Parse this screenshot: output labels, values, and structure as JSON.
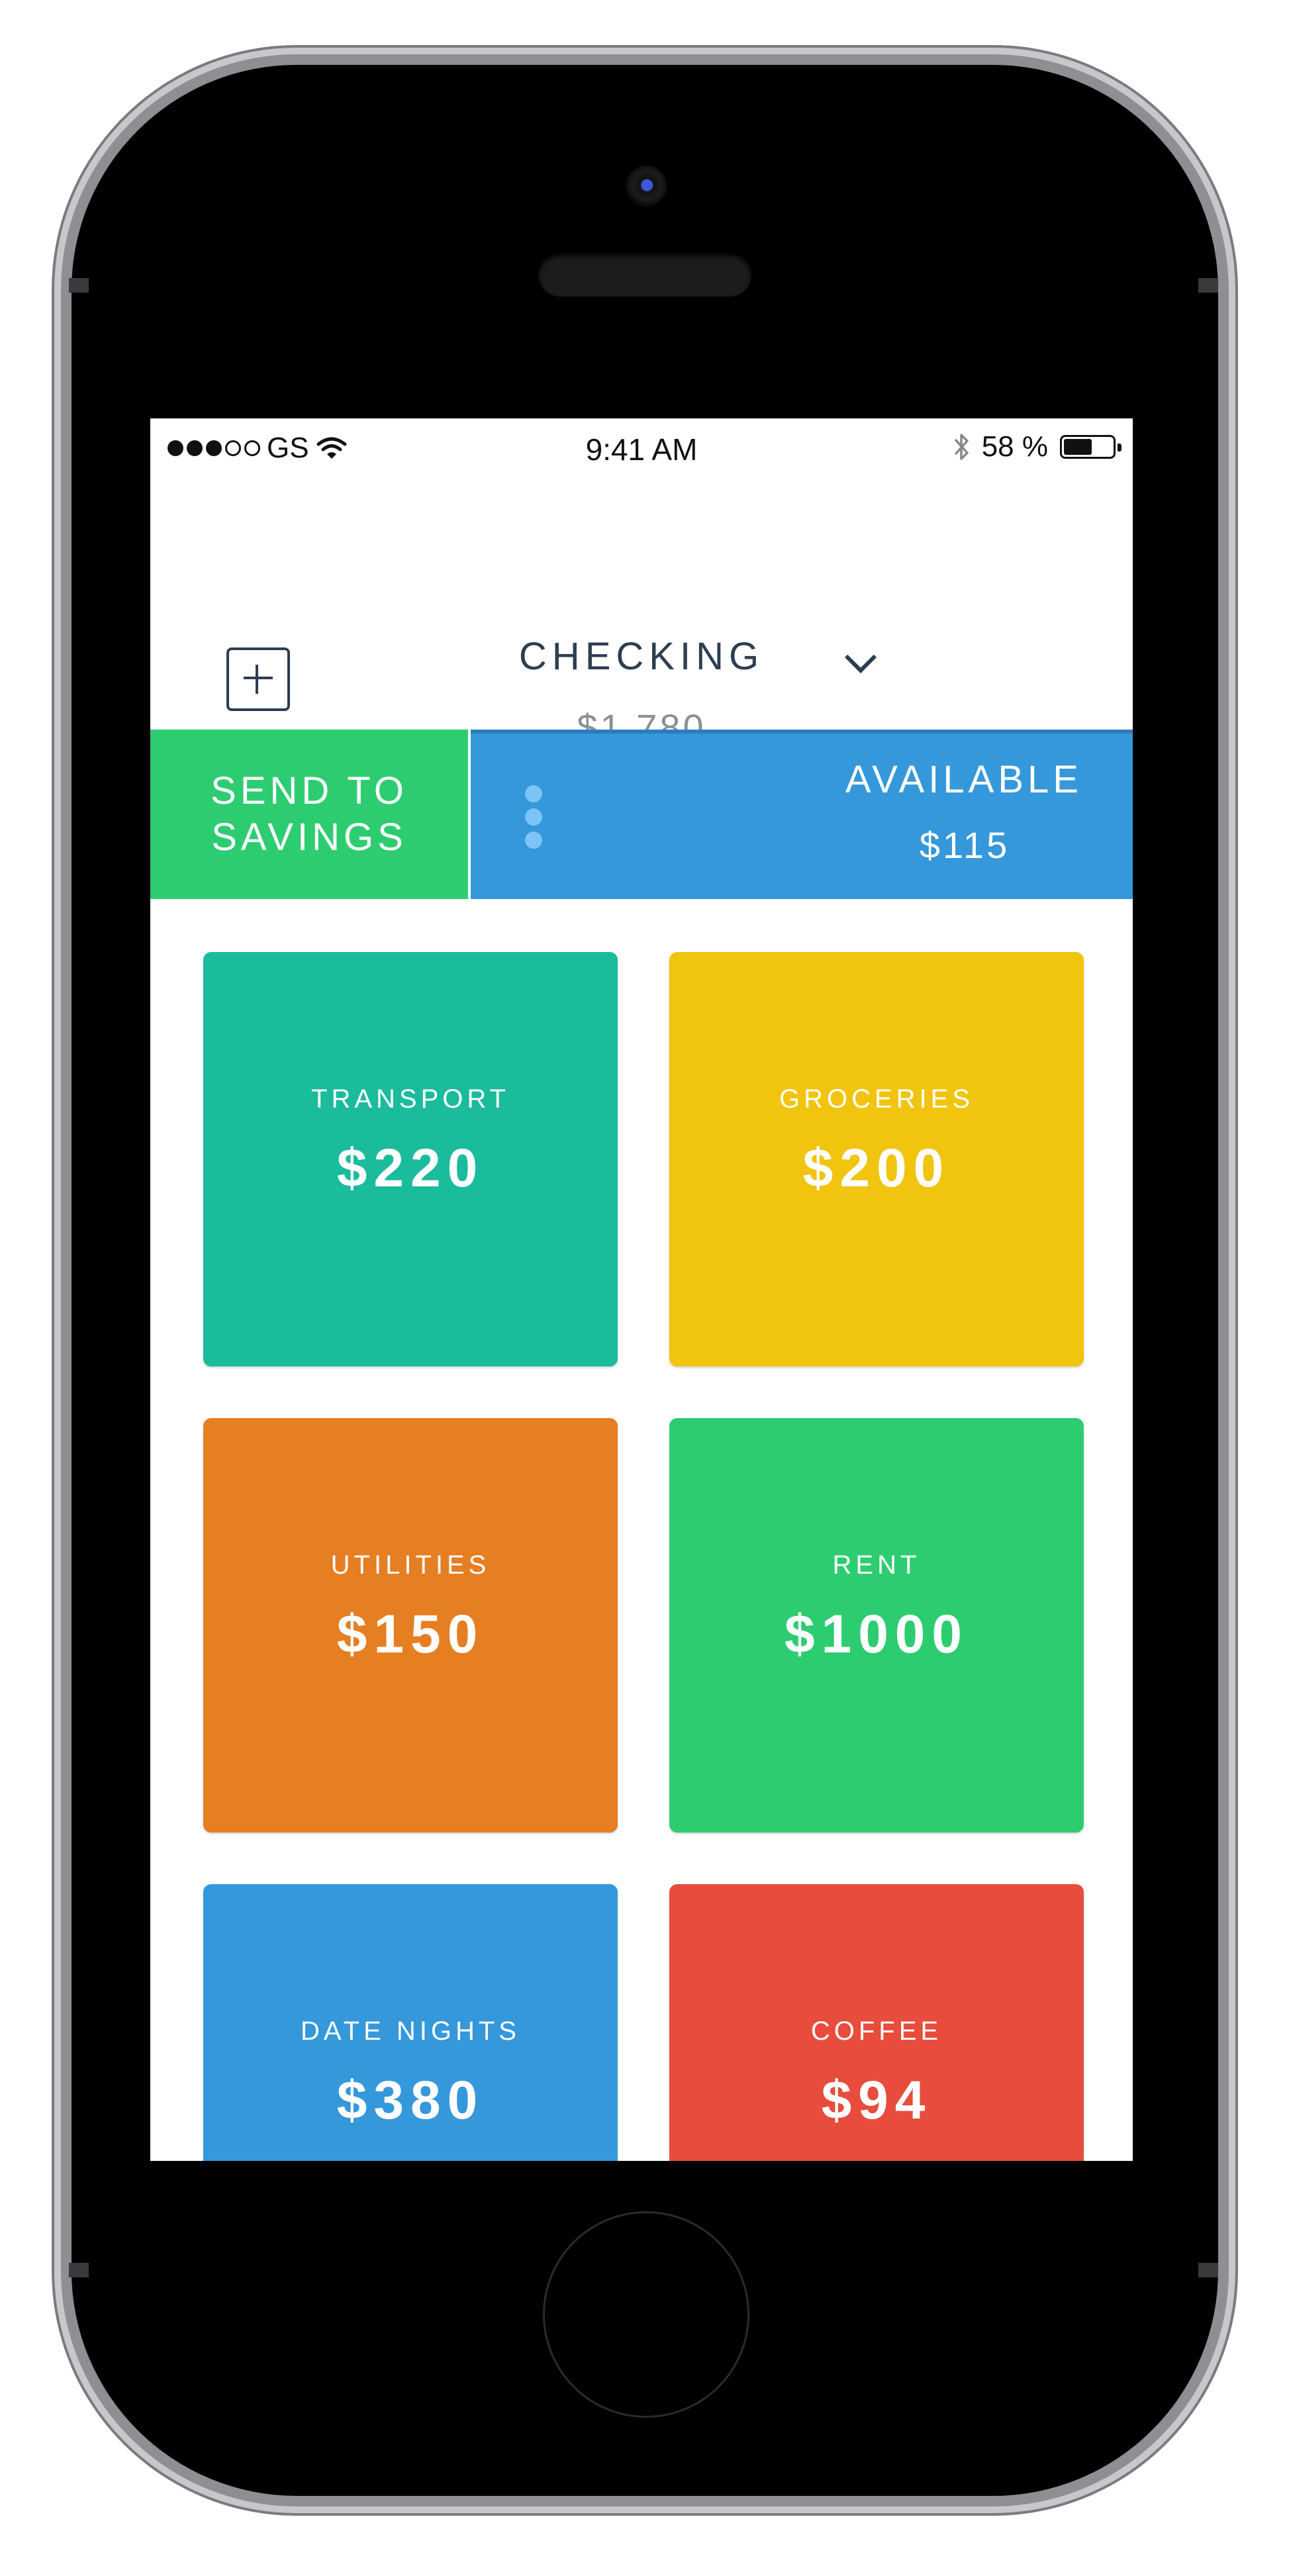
{
  "status_bar": {
    "carrier": "GS",
    "time": "9:41 AM",
    "battery": "58 %",
    "battery_level": 0.58,
    "signal_bars": 3,
    "signal_total": 5
  },
  "header": {
    "account_name": "CHECKING",
    "account_balance": "$1,780"
  },
  "actions": {
    "send_to_savings": "SEND TO SAVINGS",
    "available_label": "AVAILABLE",
    "available_amount": "$115"
  },
  "categories": [
    {
      "name": "TRANSPORT",
      "amount": "$220",
      "color": "#1abc9c"
    },
    {
      "name": "GROCERIES",
      "amount": "$200",
      "color": "#f1c40f"
    },
    {
      "name": "UTILITIES",
      "amount": "$150",
      "color": "#e67e22"
    },
    {
      "name": "RENT",
      "amount": "$1000",
      "color": "#2ecc71"
    },
    {
      "name": "DATE NIGHTS",
      "amount": "$380",
      "color": "#3498db"
    },
    {
      "name": "COFFEE",
      "amount": "$94",
      "color": "#e74c3c"
    }
  ],
  "colors": {
    "primary_text": "#2c3e50",
    "secondary_text": "#8a9196",
    "savings_green": "#2ecc71",
    "available_blue": "#3498db"
  }
}
